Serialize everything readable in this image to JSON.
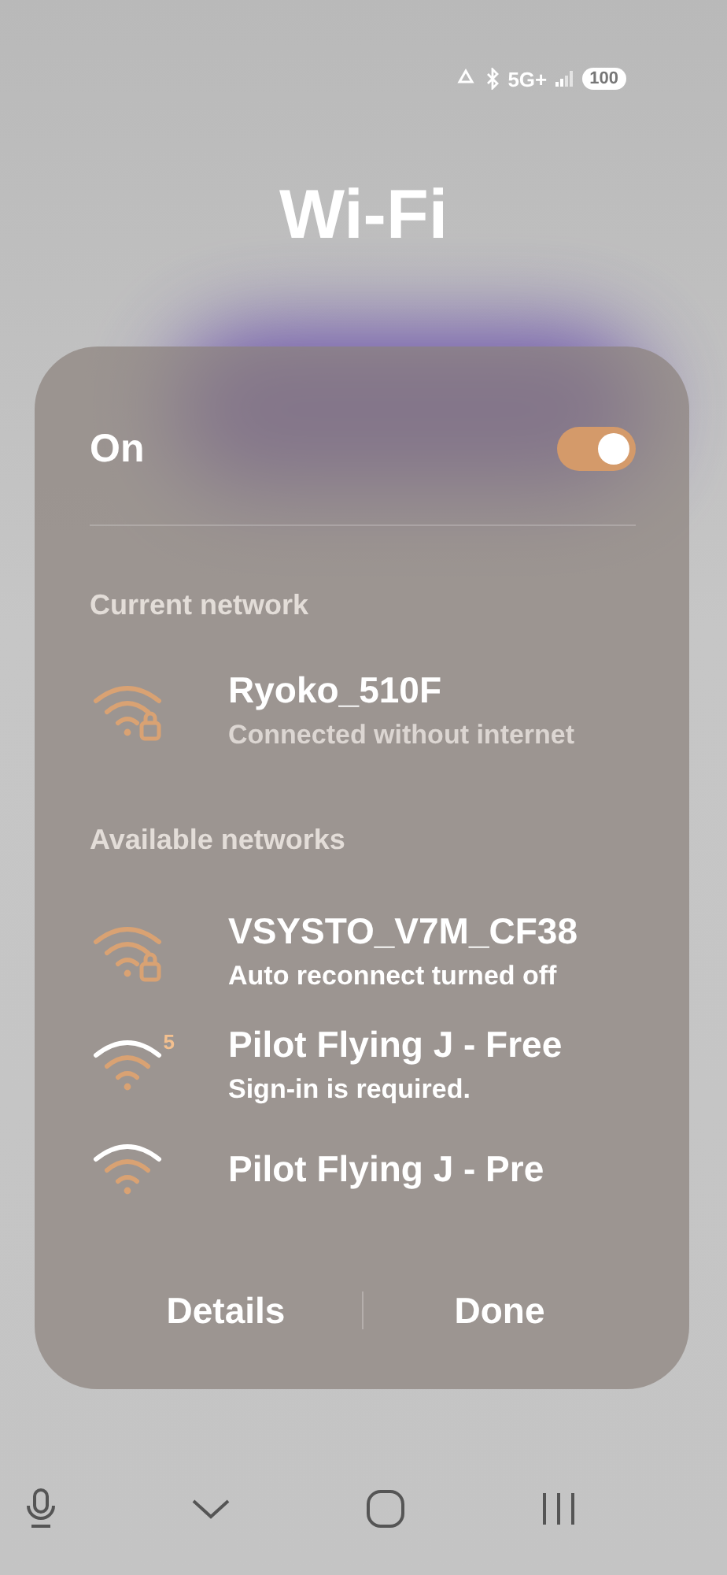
{
  "status_bar": {
    "network": "5G+",
    "battery": "100"
  },
  "title": "Wi-Fi",
  "wifi_toggle": {
    "label": "On",
    "on": true
  },
  "current_section": "Current network",
  "current_network": {
    "name": "Ryoko_510F",
    "status": "Connected without internet",
    "locked": true
  },
  "available_section": "Available networks",
  "networks": [
    {
      "name": "VSYSTO_V7M_CF38",
      "status": "Auto reconnect turned off",
      "locked": true
    },
    {
      "name": "Pilot Flying J - Free",
      "status": "Sign-in is required.",
      "locked": false,
      "band": "5"
    },
    {
      "name": "Pilot Flying J - Pre",
      "locked": false
    }
  ],
  "buttons": [
    "Details",
    "Done"
  ]
}
